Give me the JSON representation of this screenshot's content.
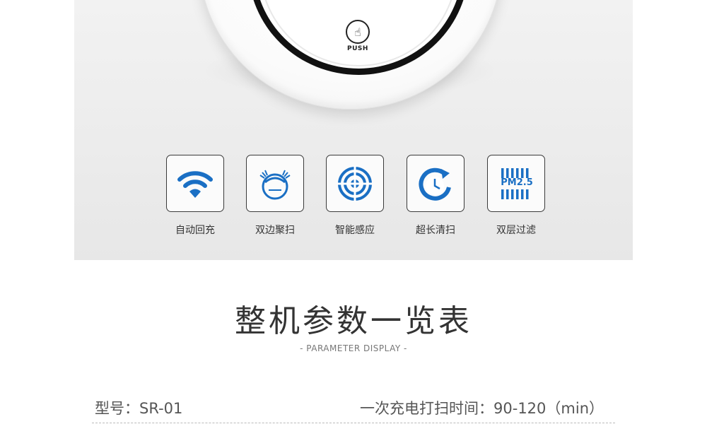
{
  "hero": {
    "push_label": "PUSH",
    "icon_color": "#1a6fc4",
    "features": [
      {
        "label": "自动回充",
        "icon": "wifi-icon"
      },
      {
        "label": "双边聚扫",
        "icon": "robot-face-icon"
      },
      {
        "label": "智能感应",
        "icon": "target-icon"
      },
      {
        "label": "超长清扫",
        "icon": "clock-refresh-icon"
      },
      {
        "label": "双层过滤",
        "icon": "pm25-filter-icon"
      }
    ],
    "pm_text": "PM2.5"
  },
  "section": {
    "title": "整机参数一览表",
    "subtitle": "- PARAMETER DISPLAY -"
  },
  "params": {
    "model": "型号：SR-01",
    "charge_time": "一次充电打扫时间：90-120（min）"
  }
}
